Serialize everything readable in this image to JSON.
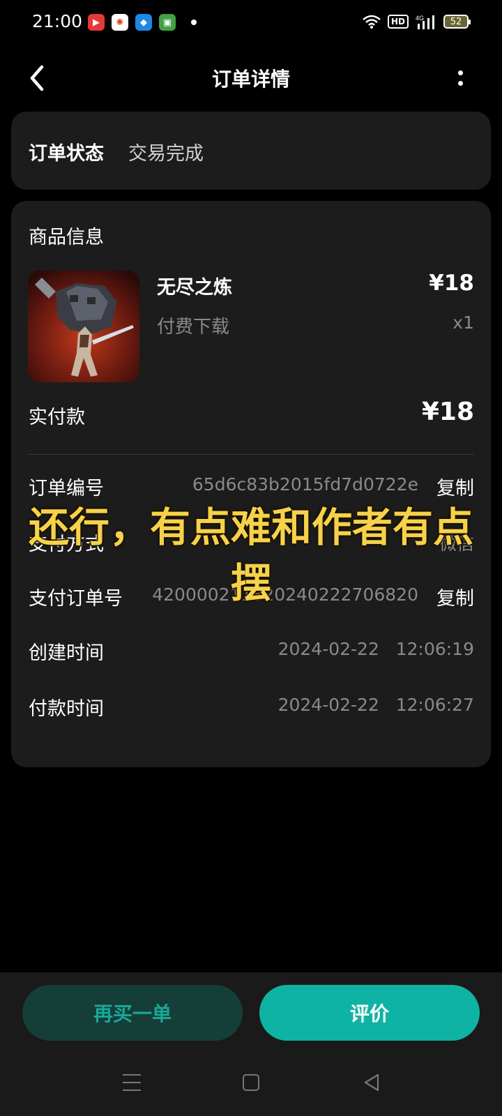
{
  "status_bar": {
    "time": "21:00",
    "hd": "HD",
    "network": "4G",
    "battery": "52"
  },
  "header": {
    "title": "订单详情"
  },
  "order_status": {
    "label": "订单状态",
    "value": "交易完成"
  },
  "goods": {
    "section_title": "商品信息",
    "product_name": "无尽之炼",
    "price": "¥18",
    "type": "付费下载",
    "quantity": "x1",
    "paid_label": "实付款",
    "paid_value": "¥18"
  },
  "details": [
    {
      "label": "订单编号",
      "value": "65d6c83b2015fd7d0722e",
      "copy": "复制"
    },
    {
      "label": "支付方式",
      "value": "微信"
    },
    {
      "label": "支付订单号",
      "value": "420000211820240222706820",
      "copy": "复制"
    },
    {
      "label": "创建时间",
      "value": "2024-02-22   12:06:19"
    },
    {
      "label": "付款时间",
      "value": "2024-02-22   12:06:27"
    }
  ],
  "overlay": {
    "line1": "还行，有点难和作者有点",
    "line2": "摆"
  },
  "actions": {
    "rebuy": "再买一单",
    "review": "评价"
  },
  "colors": {
    "accent": "#0fb3a3",
    "accent_dark": "#163e39",
    "card_bg": "#1c1c1c",
    "overlay_text": "#f6d24a"
  },
  "icons": {
    "back": "chevron-left-icon",
    "more": "more-vertical-icon",
    "nav_menu": "menu-icon",
    "nav_home": "home-square-icon",
    "nav_back": "triangle-back-icon"
  }
}
